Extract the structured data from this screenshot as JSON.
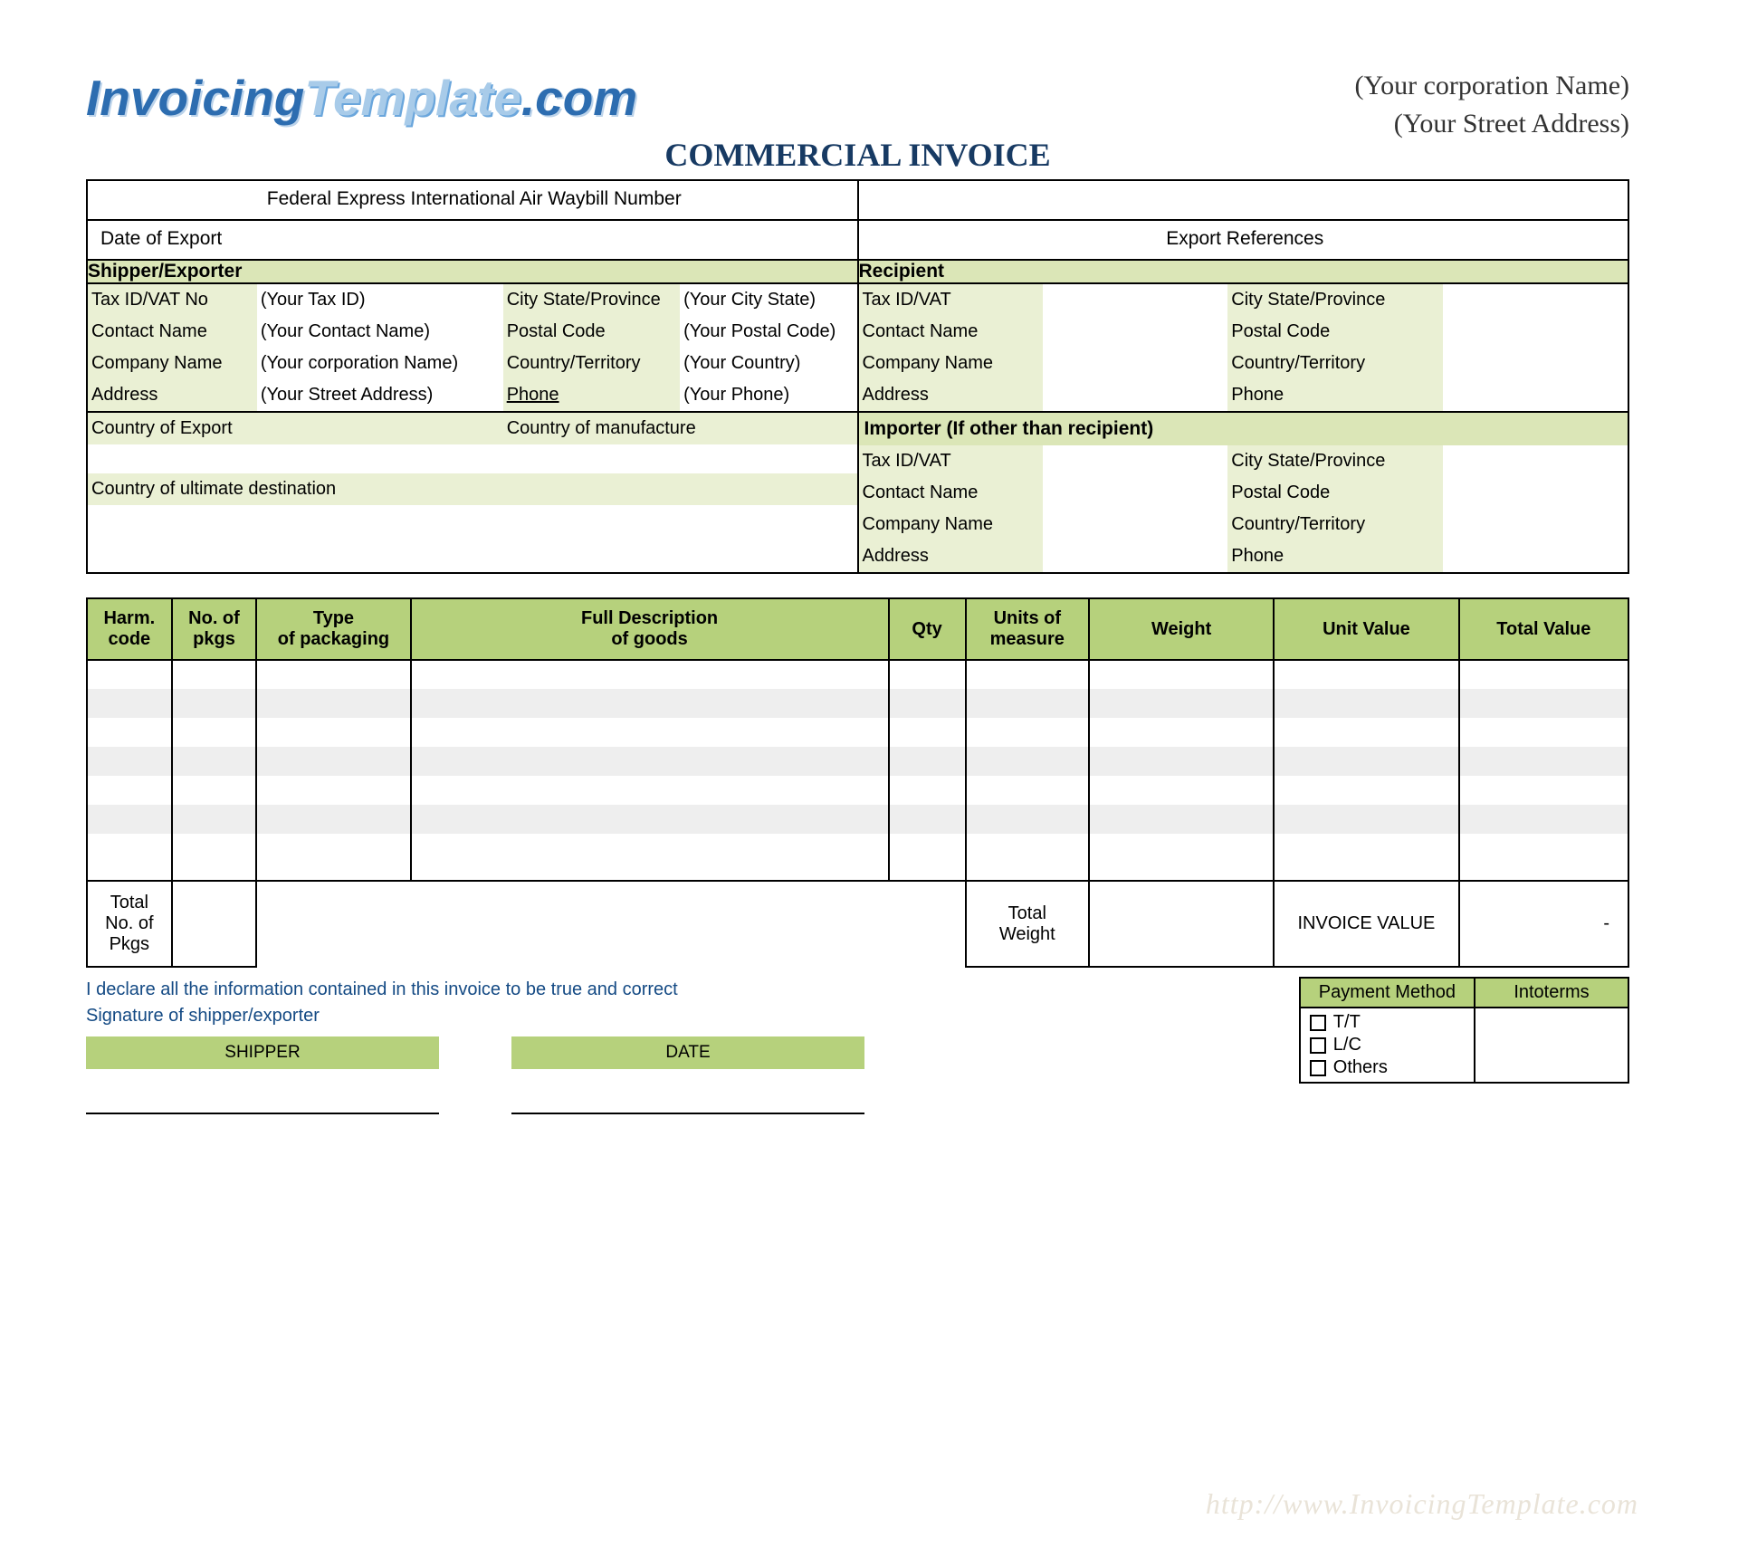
{
  "header": {
    "logo_part1": "Invoicing",
    "logo_part2": "Template",
    "logo_part3": ".com",
    "corp_name": "(Your corporation  Name)",
    "corp_addr": "(Your Street Address)",
    "title": "COMMERCIAL INVOICE"
  },
  "top": {
    "waybill_label": "Federal Express International Air Waybill Number",
    "date_of_export_label": "Date of Export",
    "export_refs_label": "Export References"
  },
  "shipper": {
    "heading": "Shipper/Exporter",
    "tax_k": "Tax ID/VAT No",
    "tax_v": "(Your Tax ID)",
    "contact_k": "Contact Name",
    "contact_v": "(Your Contact Name)",
    "company_k": "Company Name",
    "company_v": "(Your corporation  Name)",
    "address_k": "Address",
    "address_v": "(Your Street Address)",
    "city_k": "City  State/Province",
    "city_v": "(Your City State)",
    "postal_k": "Postal Code",
    "postal_v": "(Your Postal Code)",
    "country_k": "Country/Territory",
    "country_v": "(Your Country)",
    "phone_k": "Phone",
    "phone_v": "(Your Phone)"
  },
  "recipient": {
    "heading": "Recipient",
    "tax_k": "Tax ID/VAT",
    "contact_k": "Contact Name",
    "company_k": "Company Name",
    "address_k": "Address",
    "city_k": "City  State/Province",
    "postal_k": "Postal Code",
    "country_k": "Country/Territory",
    "phone_k": "Phone"
  },
  "mid": {
    "export_country_k": "Country of Export",
    "manufacture_k": "Country of manufacture",
    "ultimate_k": "Country of ultimate destination",
    "importer_heading": "Importer (If other than recipient)"
  },
  "importer": {
    "tax_k": "Tax ID/VAT",
    "contact_k": "Contact Name",
    "company_k": "Company Name",
    "address_k": "Address",
    "city_k": "City  State/Province",
    "postal_k": "Postal Code",
    "country_k": "Country/Territory",
    "phone_k": "Phone"
  },
  "items": {
    "h_harm1": "Harm.",
    "h_harm2": "code",
    "h_pkgs1": "No. of",
    "h_pkgs2": "pkgs",
    "h_type1": "Type",
    "h_type2": "of packaging",
    "h_desc1": "Full Description",
    "h_desc2": "of goods",
    "h_qty": "Qty",
    "h_uom1": "Units of",
    "h_uom2": "measure",
    "h_weight": "Weight",
    "h_unitval": "Unit Value",
    "h_totalval": "Total Value"
  },
  "totals": {
    "total_pkgs1": "Total",
    "total_pkgs2": "No. of",
    "total_pkgs3": "Pkgs",
    "total_weight1": "Total",
    "total_weight2": "Weight",
    "invoice_value": "INVOICE VALUE",
    "dash": "-"
  },
  "footer": {
    "declaration": "I declare all the information contained in this invoice to be true and correct",
    "signature_of": "Signature of shipper/exporter",
    "shipper_label": "SHIPPER",
    "date_label": "DATE",
    "pay_method_h": "Payment Method",
    "incoterms_h": "Intoterms",
    "tt": "T/T",
    "lc": "L/C",
    "others": "Others"
  },
  "watermark": "http://www.InvoicingTemplate.com"
}
